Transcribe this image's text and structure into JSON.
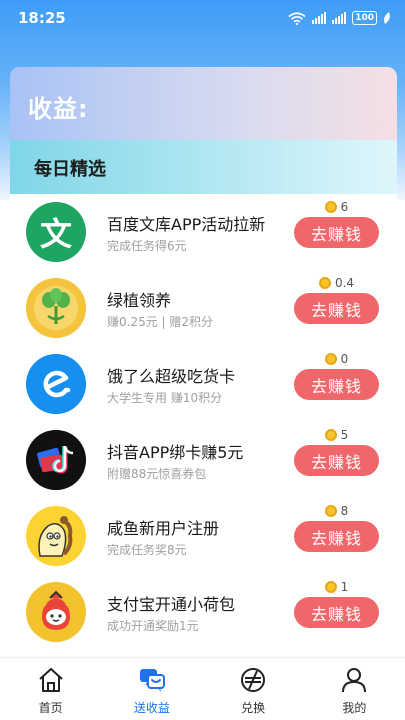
{
  "status_bar": {
    "time": "18:25",
    "battery": "100"
  },
  "card": {
    "title": "收益:",
    "section_title": "每日精选"
  },
  "tasks": [
    {
      "name": "百度文库APP活动拉新",
      "subtitle": "完成任务得6元",
      "reward": "6",
      "button": "去赚钱",
      "logo": "wenku-logo",
      "logo_text": "文",
      "logo_color": "#1fa563"
    },
    {
      "name": "绿植领养",
      "subtitle": "赚0.25元 | 赠2积分",
      "reward": "0.4",
      "button": "去赚钱",
      "logo": "plant-logo",
      "logo_color": "#f3c13a"
    },
    {
      "name": "饿了么超级吃货卡",
      "subtitle": "大学生专用 赚10积分",
      "reward": "0",
      "button": "去赚钱",
      "logo": "eleme-logo",
      "logo_color": "#1590f0"
    },
    {
      "name": "抖音APP绑卡赚5元",
      "subtitle": "附赠88元惊喜券包",
      "reward": "5",
      "button": "去赚钱",
      "logo": "douyin-logo",
      "logo_color": "#111111"
    },
    {
      "name": "咸鱼新用户注册",
      "subtitle": "完成任务奖8元",
      "reward": "8",
      "button": "去赚钱",
      "logo": "xianyu-logo",
      "logo_color": "#fdd334"
    },
    {
      "name": "支付宝开通小荷包",
      "subtitle": "成功开通奖励1元",
      "reward": "1",
      "button": "去赚钱",
      "logo": "alipay-logo",
      "logo_color": "#f2c32e"
    }
  ],
  "tabs": [
    {
      "label": "首页",
      "icon": "home-icon",
      "active": false
    },
    {
      "label": "送收益",
      "icon": "chat-earn-icon",
      "active": true
    },
    {
      "label": "兑换",
      "icon": "exchange-icon",
      "active": false
    },
    {
      "label": "我的",
      "icon": "person-icon",
      "active": false
    }
  ],
  "colors": {
    "accent": "#1f73e6",
    "button": "#f0676b",
    "coin": "#f6c32b"
  }
}
